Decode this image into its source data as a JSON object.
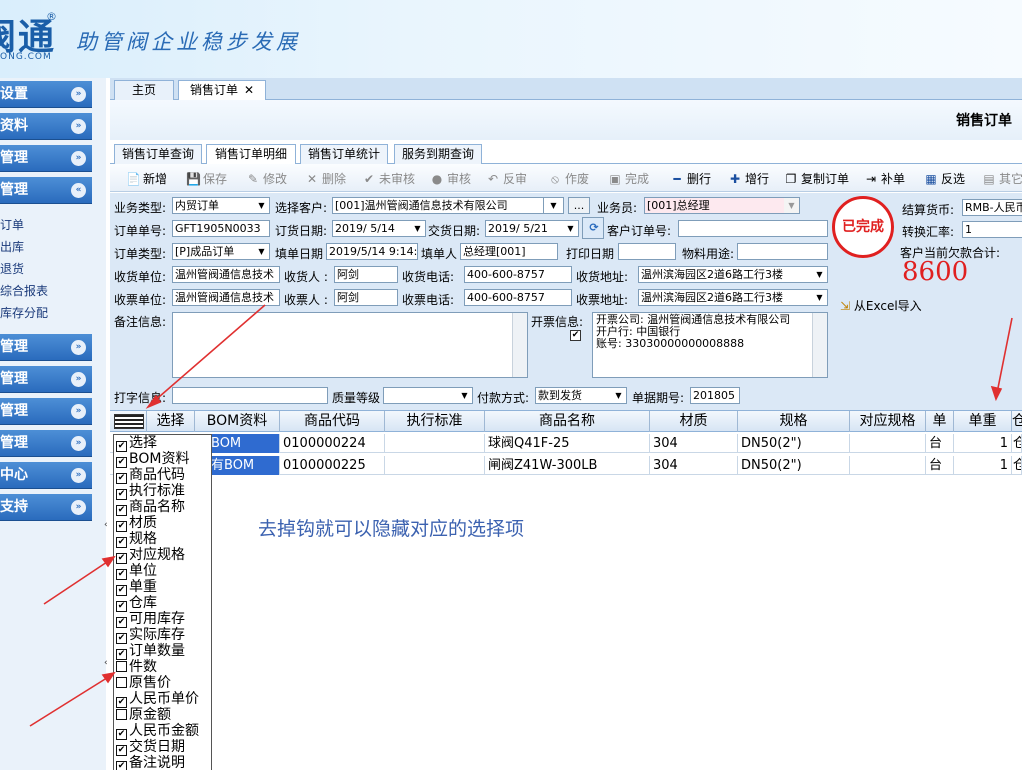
{
  "header": {
    "logo": "阀通",
    "logo_reg": "®",
    "logo_sub": "ONG.COM",
    "slogan": "助管阀企业稳步发展"
  },
  "sidebar": {
    "items": [
      {
        "label": "设置",
        "chev": "»"
      },
      {
        "label": "资料",
        "chev": "»"
      },
      {
        "label": "管理",
        "chev": "»"
      },
      {
        "label": "管理",
        "chev": "«"
      },
      {
        "label": "管理",
        "chev": "»"
      },
      {
        "label": "管理",
        "chev": "»"
      },
      {
        "label": "管理",
        "chev": "»"
      },
      {
        "label": "管理",
        "chev": "»"
      },
      {
        "label": "中心",
        "chev": "»"
      },
      {
        "label": "支持",
        "chev": "»"
      }
    ],
    "sub_items": [
      "订单",
      "出库",
      "退货",
      "综合报表",
      "库存分配"
    ],
    "splitter_arrows": [
      "‹",
      "‹"
    ]
  },
  "top_tabs": [
    {
      "label": "主页"
    },
    {
      "label": "销售订单",
      "close": "✕"
    }
  ],
  "page_title": "销售订单",
  "sub_tabs": [
    "销售订单查询",
    "销售订单明细",
    "销售订单统计",
    "服务到期查询"
  ],
  "toolbar": [
    {
      "icon": "📄",
      "label": "新增"
    },
    {
      "icon": "💾",
      "label": "保存"
    },
    {
      "icon": "✎",
      "label": "修改"
    },
    {
      "icon": "✕",
      "label": "删除"
    },
    {
      "icon": "✔",
      "label": "未审核"
    },
    {
      "icon": "●",
      "label": "审核"
    },
    {
      "icon": "↶",
      "label": "反审"
    },
    {
      "icon": "⦸",
      "label": "作废"
    },
    {
      "icon": "▣",
      "label": "完成"
    },
    {
      "icon": "━",
      "label": "删行"
    },
    {
      "icon": "✚",
      "label": "增行"
    },
    {
      "icon": "❐",
      "label": "复制订单"
    },
    {
      "icon": "⇥",
      "label": "补单"
    },
    {
      "icon": "▦",
      "label": "反选"
    },
    {
      "icon": "▤",
      "label": "其它"
    }
  ],
  "form": {
    "business_type_label": "业务类型:",
    "business_type": "内贸订单",
    "select_customer_label": "选择客户:",
    "customer": "[001]温州管阀通信息技术有限公司",
    "browse": "...",
    "salesman_label": "业务员:",
    "salesman": "[001]总经理",
    "order_no_label": "订单单号:",
    "order_no": "GFT1905N0033",
    "order_date_label": "订货日期:",
    "order_date": "2019/ 5/14",
    "delivery_date_label": "交货日期:",
    "delivery_date": "2019/ 5/21",
    "customer_order_label": "客户订单号:",
    "customer_order": "",
    "order_type_label": "订单类型:",
    "order_type": "[P]成品订单",
    "fill_date_label": "填单日期",
    "fill_date": "2019/5/14 9:14:",
    "filler_label": "填单人",
    "filler": "总经理[001]",
    "print_date_label": "打印日期",
    "print_date": "",
    "material_use_label": "物料用途:",
    "material_use": "",
    "receiver_unit_label": "收货单位:",
    "receiver_unit": "温州管阀通信息技术",
    "receiver_label": "收货人 :",
    "receiver": "阿剑",
    "receiver_phone_label": "收货电话:",
    "receiver_phone": "400-600-8757",
    "receiver_addr_label": "收货地址:",
    "receiver_addr": "温州滨海园区2道6路工行3楼",
    "invoice_unit_label": "收票单位:",
    "invoice_unit": "温州管阀通信息技术",
    "invoice_person_label": "收票人 :",
    "invoice_person": "阿剑",
    "invoice_phone_label": "收票电话:",
    "invoice_phone": "400-600-8757",
    "invoice_addr_label": "收票地址:",
    "invoice_addr": "温州滨海园区2道6路工行3楼",
    "remark_label": "备注信息:",
    "remark": "",
    "invoice_info_label": "开票信息:",
    "invoice_info": "开票公司: 温州管阀通信息技术有限公司\n开户行: 中国银行\n账号: 33030000000008888",
    "print_info_label": "打字信息:",
    "print_info": "",
    "quality_label": "质量等级",
    "quality": "",
    "payment_label": "付款方式:",
    "payment": "款到发货",
    "period_label": "单据期号:",
    "period": "201805",
    "currency_label": "结算货币:",
    "currency": "RMB-人民币",
    "rate_label": "转换汇率:",
    "rate": "1",
    "debt_label": "客户当前欠款合计:",
    "debt": "8600",
    "status_stamp": "已完成",
    "excel_import": "从Excel导入"
  },
  "grid": {
    "columns": [
      "选择",
      "BOM资料",
      "商品代码",
      "执行标准",
      "商品名称",
      "材质",
      "规格",
      "对应规格",
      "单",
      "单重",
      "仓"
    ],
    "rows": [
      {
        "bom": "有BOM",
        "code": "0100000224",
        "standard": "",
        "name": "球阀Q41F-25",
        "material": "304",
        "spec": "DN50(2\")",
        "match_spec": "",
        "unit": "台",
        "weight": "1",
        "warehouse": "仓"
      },
      {
        "bom": "没有BOM",
        "code": "0100000225",
        "standard": "",
        "name": "闸阀Z41W-300LB",
        "material": "304",
        "spec": "DN50(2\")",
        "match_spec": "",
        "unit": "台",
        "weight": "1",
        "warehouse": "仓"
      }
    ]
  },
  "hint": "去掉钩就可以隐藏对应的选择项",
  "column_menu": [
    {
      "label": "选择",
      "checked": true
    },
    {
      "label": "BOM资料",
      "checked": true
    },
    {
      "label": "商品代码",
      "checked": true
    },
    {
      "label": "执行标准",
      "checked": true
    },
    {
      "label": "商品名称",
      "checked": true
    },
    {
      "label": "材质",
      "checked": true
    },
    {
      "label": "规格",
      "checked": true
    },
    {
      "label": "对应规格",
      "checked": true
    },
    {
      "label": "单位",
      "checked": true
    },
    {
      "label": "单重",
      "checked": true
    },
    {
      "label": "仓库",
      "checked": true
    },
    {
      "label": "可用库存",
      "checked": true
    },
    {
      "label": "实际库存",
      "checked": true
    },
    {
      "label": "订单数量",
      "checked": true
    },
    {
      "label": "件数",
      "checked": false
    },
    {
      "label": "原售价",
      "checked": false
    },
    {
      "label": "人民币单价",
      "checked": true
    },
    {
      "label": "原金额",
      "checked": false
    },
    {
      "label": "人民币金额",
      "checked": true
    },
    {
      "label": "交货日期",
      "checked": true
    },
    {
      "label": "备注说明",
      "checked": true
    }
  ],
  "colors": {
    "accent": "#2a6bbd",
    "stamp_red": "#e02020",
    "hint_blue": "#3c62b0",
    "arrow_red": "#e03030"
  }
}
